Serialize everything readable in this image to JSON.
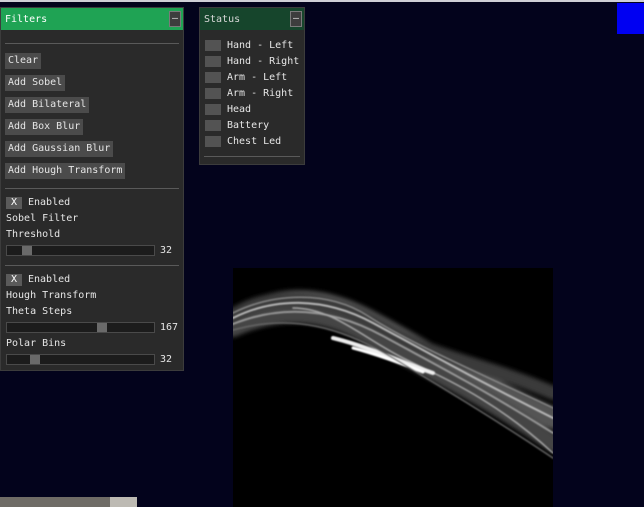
{
  "filters_panel": {
    "title": "Filters",
    "collapse_label": "–",
    "buttons": {
      "clear": "Clear",
      "add_sobel": "Add Sobel",
      "add_bilateral": "Add Bilateral",
      "add_box_blur": "Add Box Blur",
      "add_gaussian_blur": "Add Gaussian Blur",
      "add_hough_transform": "Add Hough Transform"
    },
    "sobel": {
      "enabled_mark": "X",
      "enabled_label": "Enabled",
      "name": "Sobel Filter",
      "threshold_label": "Threshold",
      "threshold_value": "32",
      "threshold_fraction": 0.13
    },
    "hough": {
      "enabled_mark": "X",
      "enabled_label": "Enabled",
      "name": "Hough Transform",
      "theta_label": "Theta Steps",
      "theta_value": "167",
      "theta_fraction": 0.65,
      "polar_label": "Polar Bins",
      "polar_value": "32",
      "polar_fraction": 0.19
    }
  },
  "status_panel": {
    "title": "Status",
    "collapse_label": "–",
    "items": [
      "Hand - Left",
      "Hand - Right",
      "Arm - Left",
      "Arm - Right",
      "Head",
      "Battery",
      "Chest Led"
    ]
  },
  "colors": {
    "background": "#03031c",
    "header_active": "#1fa354",
    "header_inactive": "#16452c",
    "indicator": "#0000f2"
  },
  "icons": [
    "collapse-icon",
    "checkbox-check-icon"
  ]
}
